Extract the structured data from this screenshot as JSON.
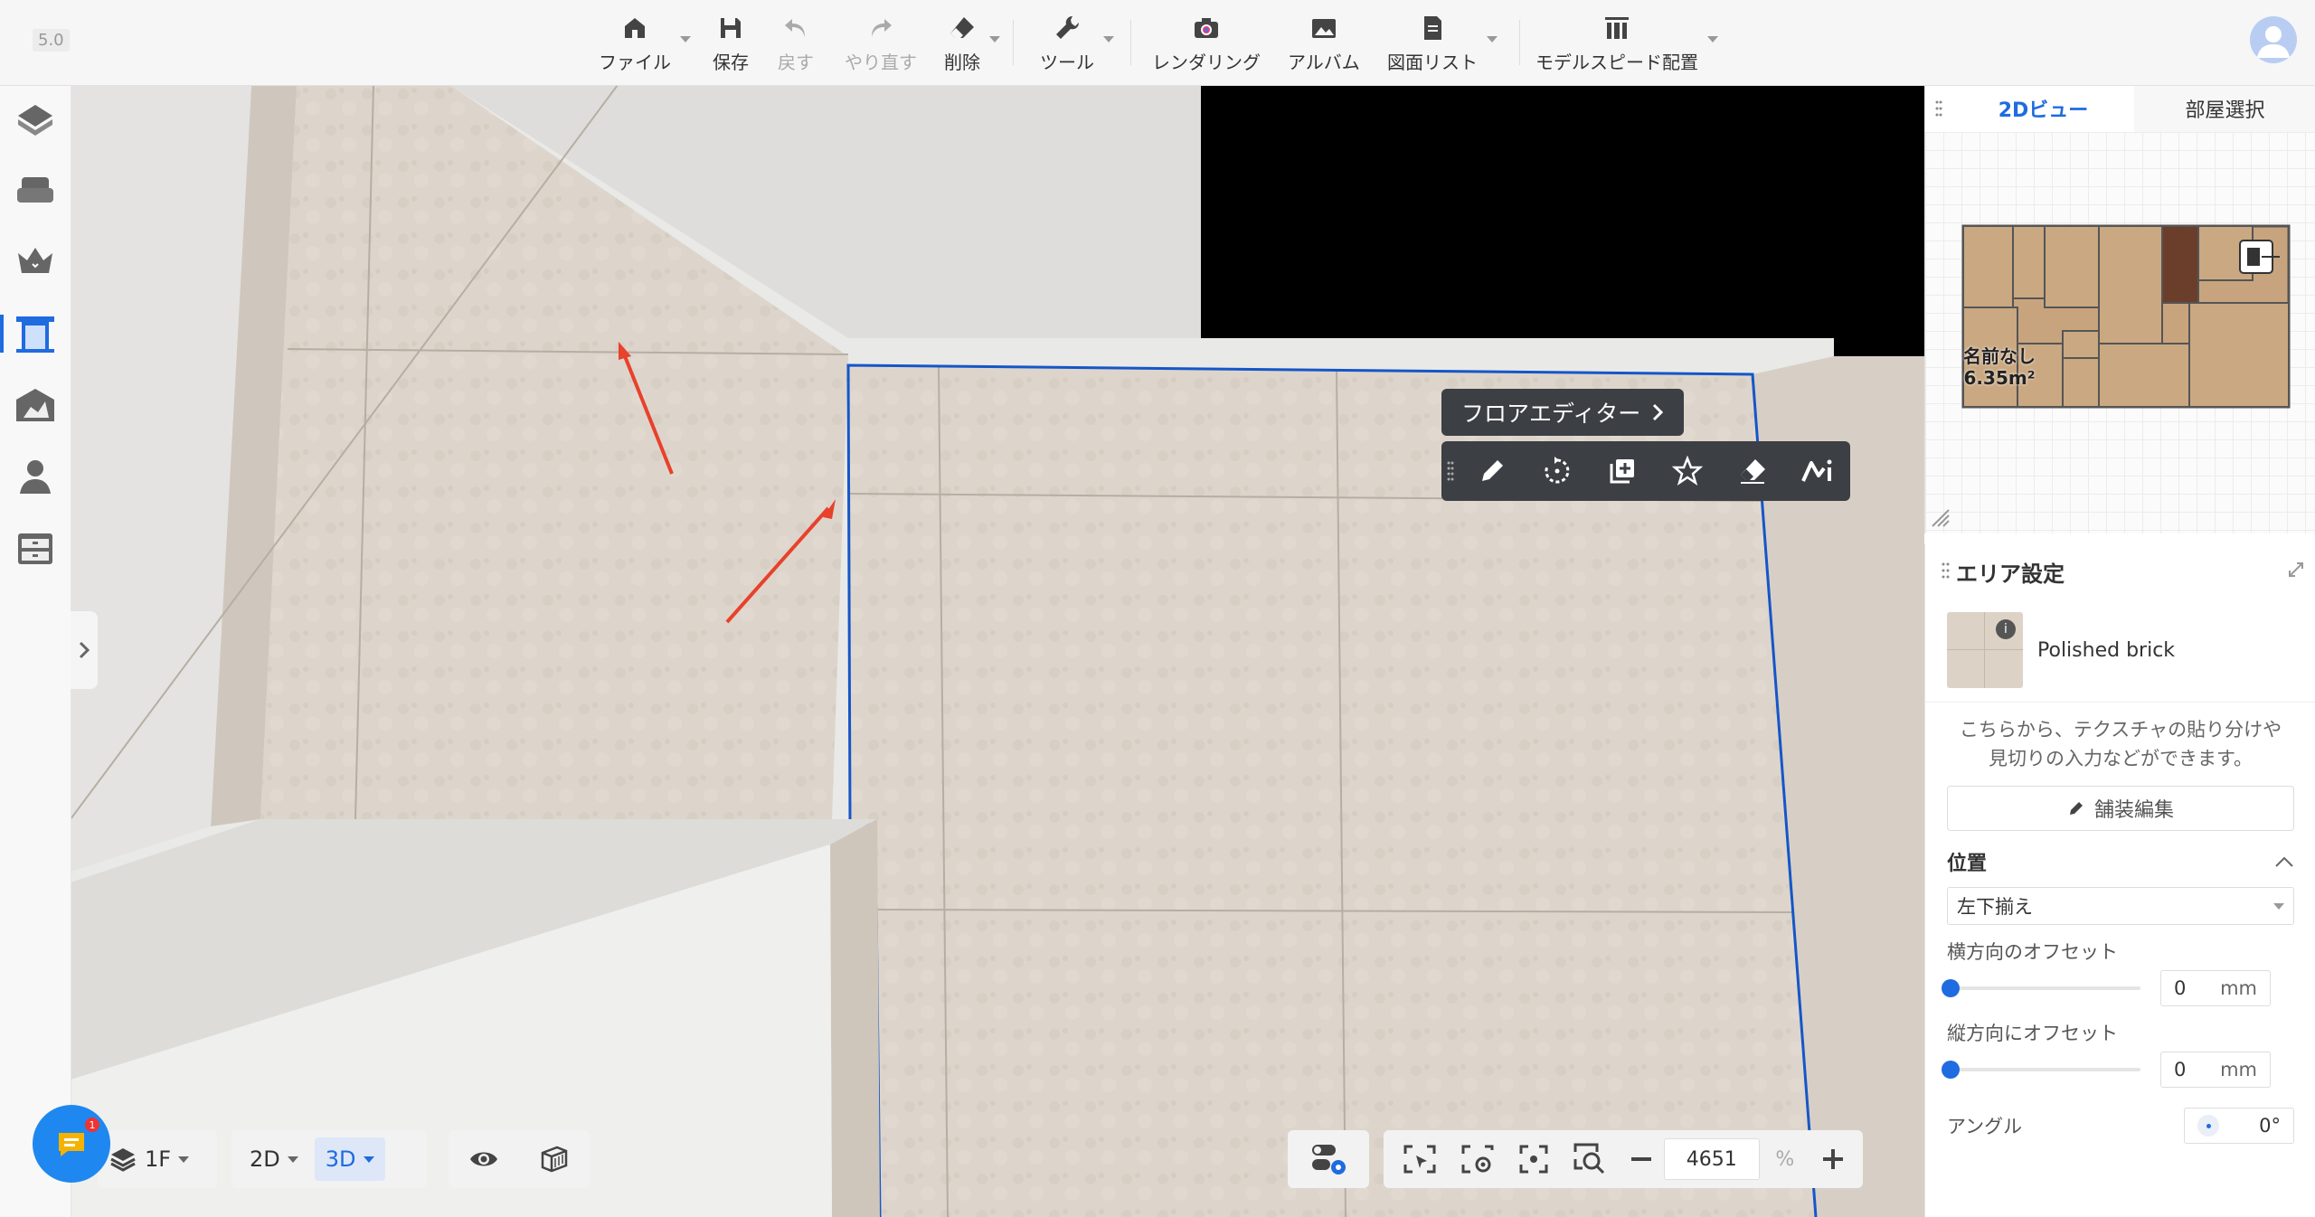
{
  "app": {
    "version": "5.0"
  },
  "toolbar": {
    "file": "ファイル",
    "save": "保存",
    "undo": "戻す",
    "redo": "やり直す",
    "delete": "削除",
    "tools": "ツール",
    "rendering": "レンダリング",
    "album": "アルバム",
    "drawing_list": "図面リスト",
    "model_speed": "モデルスピード配置"
  },
  "sidebar": {
    "items": [
      "cube-icon",
      "sofa-icon",
      "crown-icon",
      "door-icon",
      "wall-icon",
      "person-icon",
      "cabinet-icon"
    ],
    "active_index": 3
  },
  "floor_editor": {
    "title": "フロアエディター",
    "tools": [
      "pencil-icon",
      "rotate-icon",
      "add-copy-icon",
      "star-icon",
      "eraser-icon",
      "ai-icon"
    ]
  },
  "minimap": {
    "tabs": [
      "2Dビュー",
      "部屋選択"
    ],
    "active_tab": 0,
    "room_name": "名前なし",
    "room_area": "6.35m²"
  },
  "area_settings": {
    "title": "エリア設定",
    "material_name": "Polished brick",
    "description_line1": "こちらから、テクスチャの貼り分けや",
    "description_line2": "見切りの入力などができます。",
    "pave_button": "舗装編集",
    "position_title": "位置",
    "alignment_value": "左下揃え",
    "h_offset_label": "横方向のオフセット",
    "h_offset_value": "0",
    "h_offset_unit": "mm",
    "v_offset_label": "縦方向にオフセット",
    "v_offset_value": "0",
    "v_offset_unit": "mm",
    "angle_label": "アングル",
    "angle_value": "0°"
  },
  "bottom": {
    "floor": "1F",
    "view_2d": "2D",
    "view_3d": "3D",
    "zoom_value": "4651",
    "zoom_unit": "%",
    "chat_badge": "1"
  },
  "colors": {
    "accent": "#1f6be0",
    "selection_outline": "#1556c8",
    "annotation_arrow": "#e8412c",
    "editor_bar": "#3c3f44"
  }
}
